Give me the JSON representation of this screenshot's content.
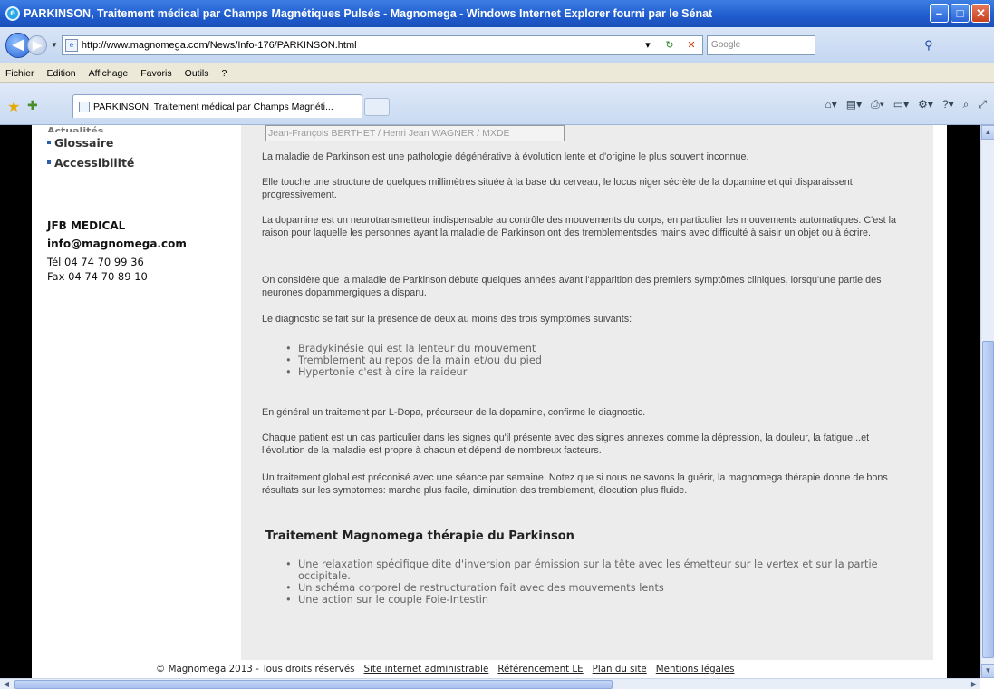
{
  "window": {
    "title": "PARKINSON, Traitement médical par Champs Magnétiques Pulsés - Magnomega - Windows Internet Explorer fourni par le Sénat",
    "minimize_icon": "minimize-icon",
    "maximize_icon": "maximize-icon",
    "close_icon": "close-icon"
  },
  "address": {
    "url": "http://www.magnomega.com/News/Info-176/PARKINSON.html",
    "search_placeholder": "Google"
  },
  "menu": [
    "Fichier",
    "Edition",
    "Affichage",
    "Favoris",
    "Outils",
    "?"
  ],
  "tab": {
    "label": "PARKINSON, Traitement médical par Champs Magnéti..."
  },
  "sidebar": {
    "items": [
      {
        "label": "Actualités"
      },
      {
        "label": "Glossaire"
      },
      {
        "label": "Accessibilité"
      }
    ],
    "contact": {
      "company": "JFB MEDICAL",
      "email": "info@magnomega.com",
      "tel": "Tél 04 74 70 99 36",
      "fax": "Fax 04 74 70 89 10"
    }
  },
  "content": {
    "credits": "Jean-François BERTHET / Henri Jean WAGNER / MXDE",
    "p1": "La maladie de Parkinson est une pathologie dégénérative à évolution lente et d'origine le plus souvent inconnue.",
    "p2": "Elle touche une structure de quelques millimètres située à la base du cerveau, le locus niger sécrète de la dopamine et qui disparaissent progressivement.",
    "p3": "La dopamine est un neurotransmetteur indispensable au contrôle des mouvements du corps, en particulier les mouvements automatiques. C'est la raison pour laquelle les personnes ayant la maladie de Parkinson ont des tremblementsdes mains avec difficulté à saisir un objet ou à écrire.",
    "p4": "On considère que la maladie de Parkinson débute quelques années avant l'apparition des premiers symptômes cliniques, lorsqu'une partie des neurones dopammergiques a disparu.",
    "p5": "Le diagnostic se fait sur la présence de deux au moins des trois symptômes suivants:",
    "symptoms": [
      "Bradykinésie qui est la lenteur du mouvement",
      "Tremblement au repos de la main et/ou du pied",
      "Hypertonie c'est à dire la raideur"
    ],
    "p6": "En général un traitement par L-Dopa, précurseur de la dopamine, confirme le diagnostic.",
    "p7": "Chaque patient est un cas particulier dans les signes qu'il présente avec des signes annexes comme la dépression, la douleur, la fatigue...et l'évolution de la maladie est propre à chacun et dépend de nombreux facteurs.",
    "p8": "Un traitement global est préconisé avec une séance par semaine. Notez que si nous ne savons la guérir, la magnomega thérapie donne de bons résultats sur les symptomes: marche plus facile, diminution des tremblement, élocution plus fluide.",
    "heading": "Traitement Magnomega thérapie du Parkinson",
    "treatments": [
      "Une relaxation spécifique dite d'inversion par émission sur la tête avec les émetteur sur le vertex et sur la partie occipitale.",
      "Un schéma corporel de restructuration fait avec des mouvements lents",
      "Une action sur le couple Foie-Intestin"
    ]
  },
  "footer": {
    "copyright": "© Magnomega 2013 - Tous droits réservés",
    "links": [
      "Site internet administrable",
      "Référencement LE",
      "Plan du site",
      "Mentions légales"
    ]
  }
}
